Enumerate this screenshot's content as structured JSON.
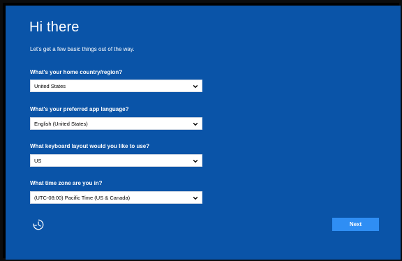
{
  "header": {
    "title": "Hi there",
    "subtitle": "Let's get a few basic things out of the way."
  },
  "fields": [
    {
      "label": "What's your home country/region?",
      "value": "United States"
    },
    {
      "label": "What's your preferred app language?",
      "value": "English (United States)"
    },
    {
      "label": "What keyboard layout would you like to use?",
      "value": "US"
    },
    {
      "label": "What time zone are you in?",
      "value": "(UTC-08:00) Pacific Time (US & Canada)"
    }
  ],
  "footer": {
    "ease_of_access_icon": "ease-of-access-icon",
    "next_label": "Next"
  },
  "colors": {
    "background": "#0a54a8",
    "button": "#2f8ef4",
    "text": "#ffffff"
  }
}
